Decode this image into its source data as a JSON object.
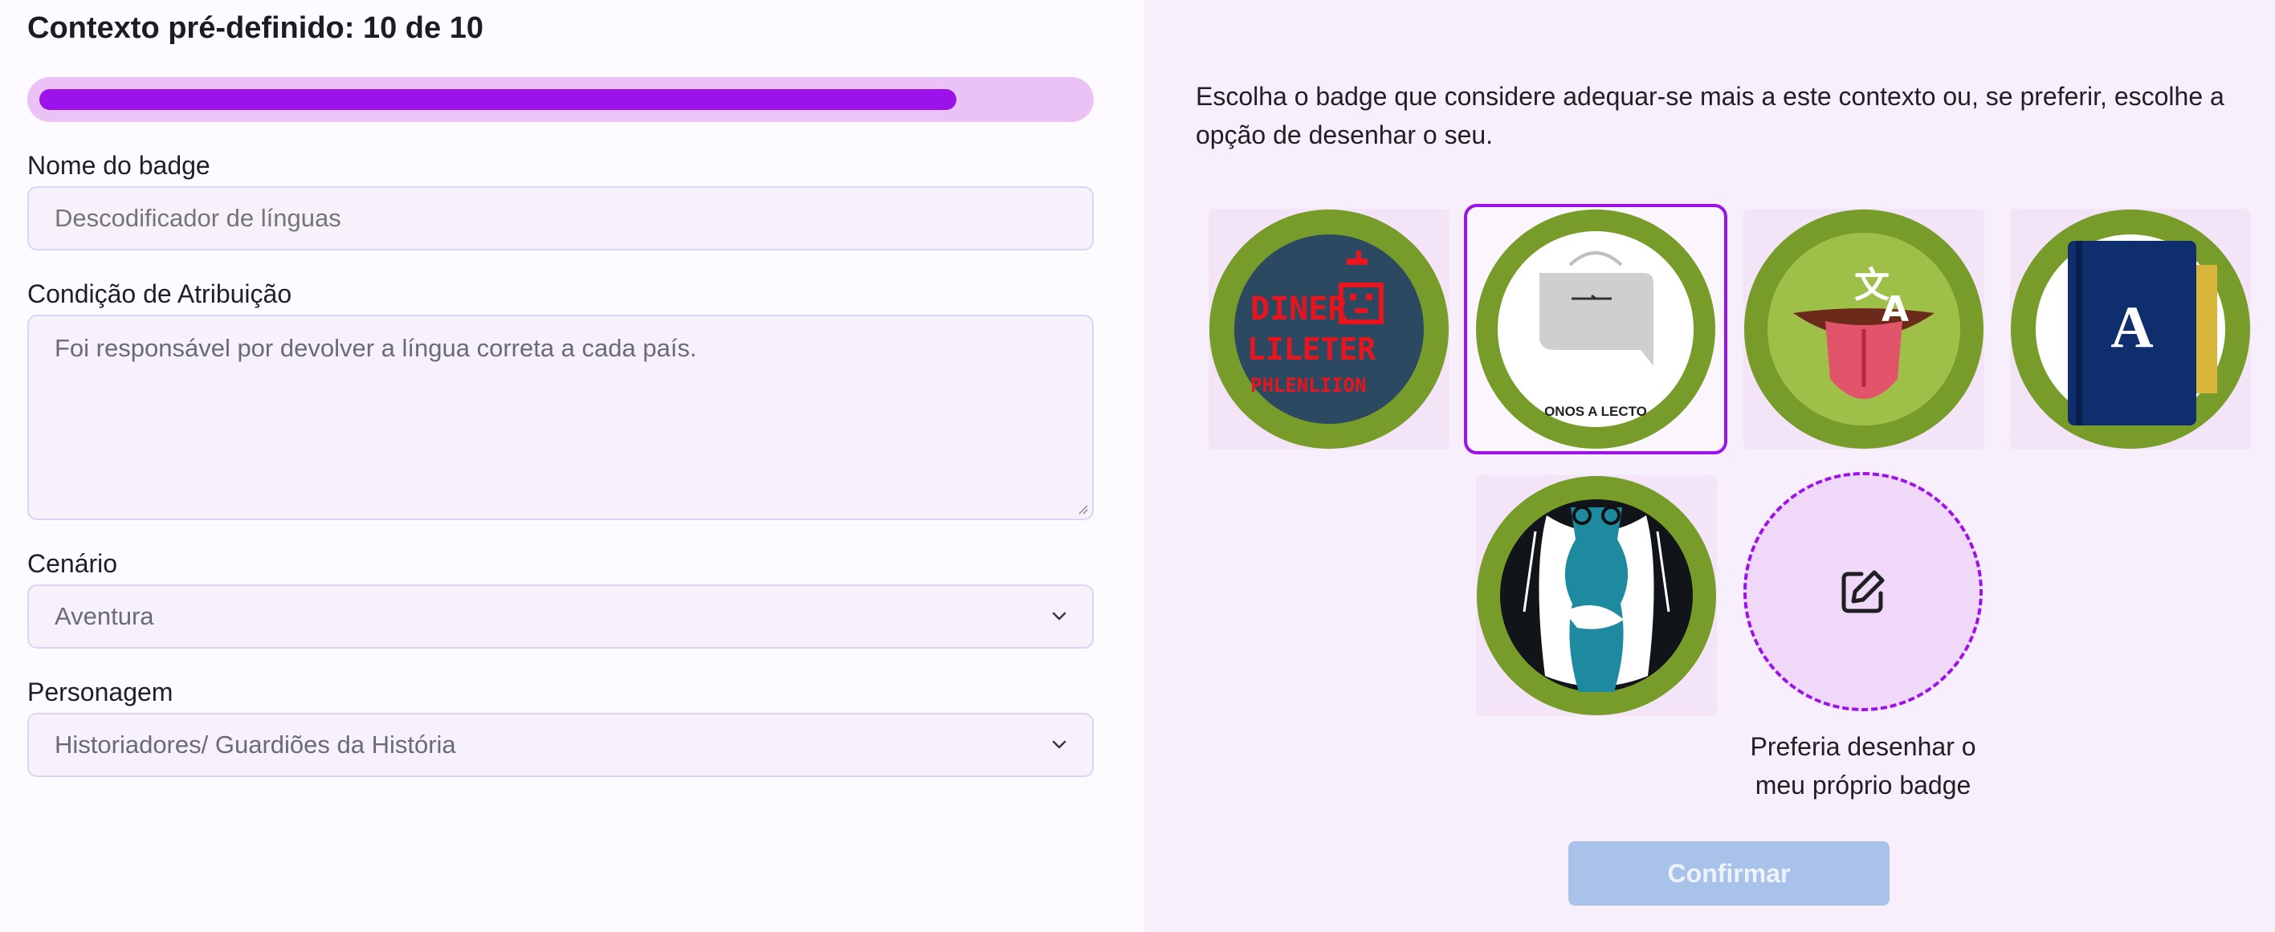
{
  "header": {
    "title": "Contexto pré-definido: 10 de 10"
  },
  "progress": {
    "fraction": 0.88
  },
  "form": {
    "badge_name": {
      "label": "Nome do badge",
      "placeholder": "Descodificador de línguas"
    },
    "condition": {
      "label": "Condição de Atribuição",
      "placeholder": "Foi responsável por devolver a língua correta a cada país."
    },
    "scenario": {
      "label": "Cenário",
      "value": "Aventura"
    },
    "character": {
      "label": "Personagem",
      "value": "Historiadores/ Guardiões da História"
    }
  },
  "panel": {
    "instructions": "Escolha o badge que considere adequar-se mais a este contexto ou, se preferir, escolhe a opção de desenhar o seu.",
    "badges": [
      {
        "icon": "pixel-robot-text-badge",
        "text_line1": "DINER",
        "text_line2": "LILETER",
        "text_line3": "PHLENLIION",
        "selected": false
      },
      {
        "icon": "speech-bag-badge",
        "caption": "ONOS A LECTO",
        "selected": true
      },
      {
        "icon": "translate-tongue-badge",
        "selected": false
      },
      {
        "icon": "blue-book-badge",
        "letter": "A",
        "selected": false
      },
      {
        "icon": "scholar-figure-badge",
        "selected": false
      }
    ],
    "draw_option": {
      "icon": "edit-pencil-icon",
      "label_line1": "Preferia desenhar o",
      "label_line2": "meu próprio badge"
    },
    "confirm_label": "Confirmar"
  },
  "colors": {
    "accent": "#9b12ea",
    "badge_ring": "#789c2a",
    "confirm_disabled": "#a9c2ea"
  }
}
